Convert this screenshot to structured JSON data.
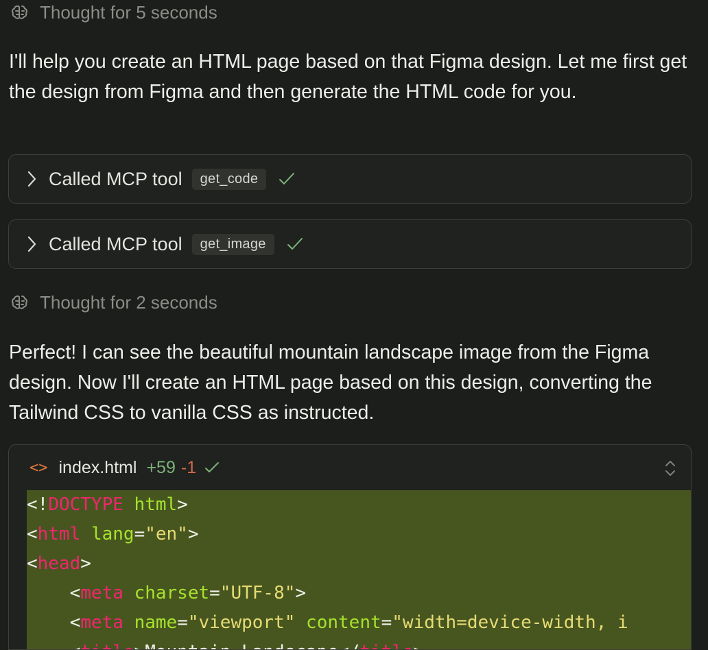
{
  "thought1": {
    "text": "Thought for 5 seconds",
    "icon": "brain-icon"
  },
  "intro": "I'll help you create an HTML page based on that Figma design. Let me first get the design from Figma and then generate the HTML code for you.",
  "tools": [
    {
      "label": "Called MCP tool",
      "name": "get_code",
      "status": "success"
    },
    {
      "label": "Called MCP tool",
      "name": "get_image",
      "status": "success"
    }
  ],
  "thought2": {
    "text": "Thought for 2 seconds",
    "icon": "brain-icon"
  },
  "response": "Perfect! I can see the beautiful mountain landscape image from the Figma design. Now I'll create an HTML page based on this design, converting the Tailwind CSS to vanilla CSS as instructed.",
  "file": {
    "icon": "<>",
    "name": "index.html",
    "additions": "+59",
    "deletions": "-1",
    "code": [
      [
        [
          "pun",
          "<!"
        ],
        [
          "tag",
          "DOCTYPE"
        ],
        [
          "pun",
          " "
        ],
        [
          "attr",
          "html"
        ],
        [
          "pun",
          ">"
        ]
      ],
      [
        [
          "pun",
          "<"
        ],
        [
          "tag",
          "html"
        ],
        [
          "pun",
          " "
        ],
        [
          "attr",
          "lang"
        ],
        [
          "pun",
          "="
        ],
        [
          "str",
          "\"en\""
        ],
        [
          "pun",
          ">"
        ]
      ],
      [
        [
          "pun",
          "<"
        ],
        [
          "tag",
          "head"
        ],
        [
          "pun",
          ">"
        ]
      ],
      [
        [
          "pun",
          "    <"
        ],
        [
          "tag",
          "meta"
        ],
        [
          "pun",
          " "
        ],
        [
          "attr",
          "charset"
        ],
        [
          "pun",
          "="
        ],
        [
          "str",
          "\"UTF-8\""
        ],
        [
          "pun",
          ">"
        ]
      ],
      [
        [
          "pun",
          "    <"
        ],
        [
          "tag",
          "meta"
        ],
        [
          "pun",
          " "
        ],
        [
          "attr",
          "name"
        ],
        [
          "pun",
          "="
        ],
        [
          "str",
          "\"viewport\""
        ],
        [
          "pun",
          " "
        ],
        [
          "attr",
          "content"
        ],
        [
          "pun",
          "="
        ],
        [
          "str",
          "\"width=device-width, i"
        ]
      ],
      [
        [
          "pun",
          "    <"
        ],
        [
          "tag",
          "title"
        ],
        [
          "pun",
          ">Mountain Landscape</"
        ],
        [
          "tag",
          "title"
        ],
        [
          "pun",
          ">"
        ]
      ]
    ]
  },
  "colors": {
    "background": "#1c1e1b",
    "success": "#7bb47a",
    "added_bg": "#47561f",
    "tag": "#f0266f",
    "attr": "#a6e22e",
    "string": "#e6db74"
  }
}
